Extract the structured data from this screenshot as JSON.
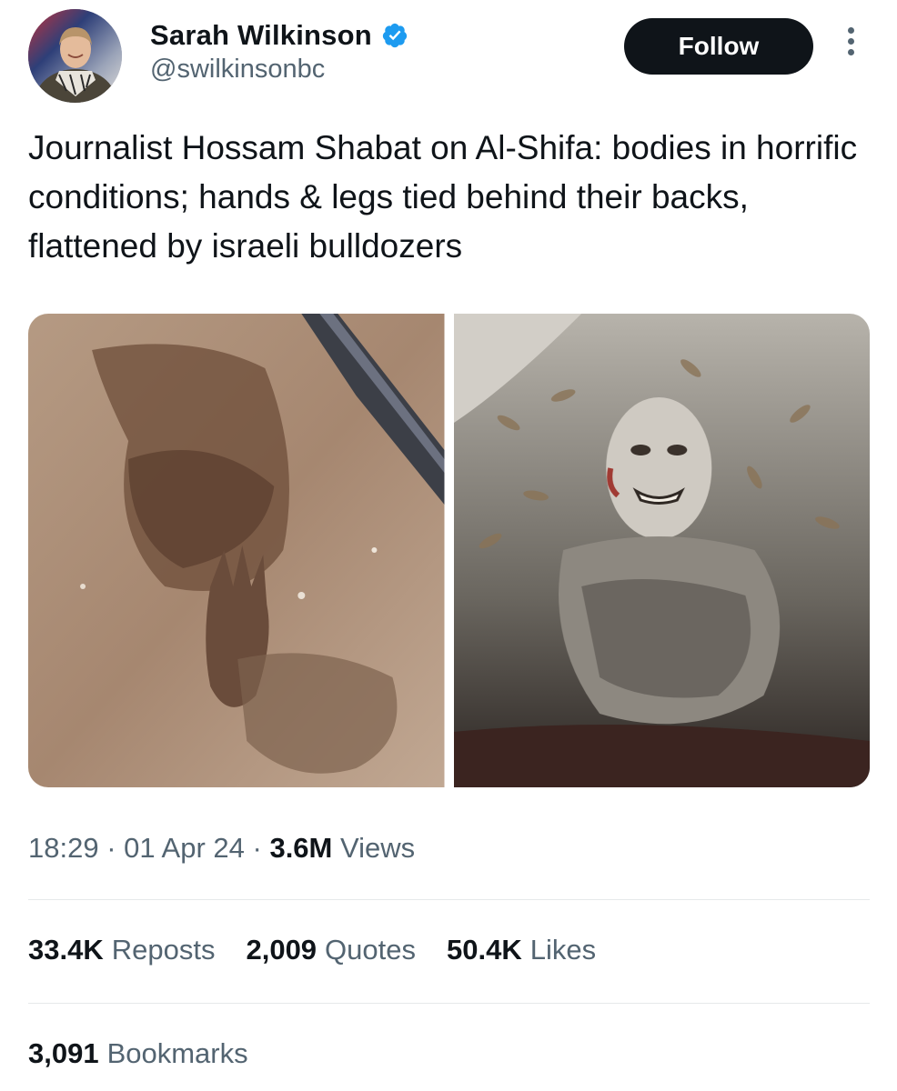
{
  "author": {
    "display_name": "Sarah Wilkinson",
    "handle": "@swilkinsonbc",
    "verified": true,
    "verified_color": "#1d9bf0"
  },
  "actions": {
    "follow_label": "Follow"
  },
  "tweet": {
    "text": "Journalist Hossam Shabat on Al-Shifa: bodies in horrific conditions; hands & legs tied behind their backs, flattened by israeli bulldozers"
  },
  "media": [
    {
      "name": "photo-1"
    },
    {
      "name": "photo-2"
    }
  ],
  "meta": {
    "time": "18:29",
    "separator": "·",
    "date": "01 Apr 24",
    "views_count": "3.6M",
    "views_label": "Views"
  },
  "stats": {
    "reposts": {
      "count": "33.4K",
      "label": "Reposts"
    },
    "quotes": {
      "count": "2,009",
      "label": "Quotes"
    },
    "likes": {
      "count": "50.4K",
      "label": "Likes"
    },
    "bookmarks": {
      "count": "3,091",
      "label": "Bookmarks"
    }
  },
  "colors": {
    "text_primary": "#0f1419",
    "text_secondary": "#536471",
    "divider": "#e6e9ea",
    "follow_bg": "#0f1419"
  }
}
